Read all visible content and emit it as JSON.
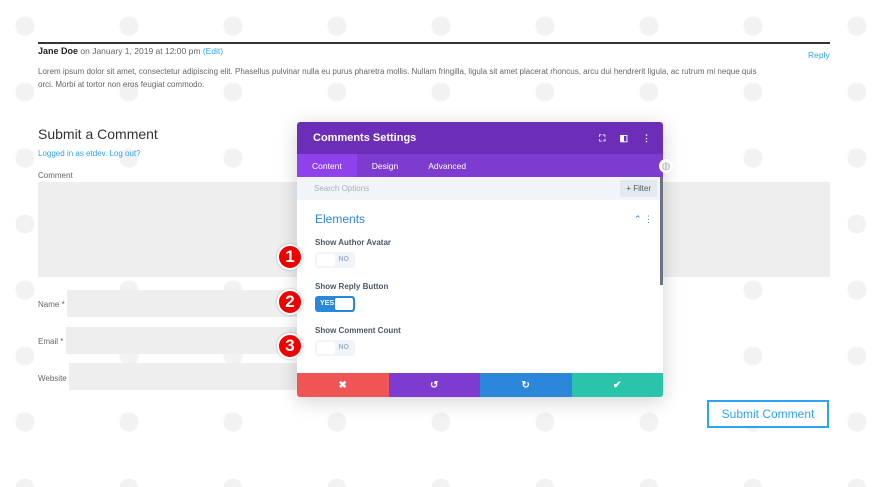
{
  "comment": {
    "author": "Jane Doe",
    "date": " on January 1, 2019 at 12:00 pm ",
    "edit": "(Edit)",
    "reply": "Reply",
    "body": "Lorem ipsum dolor sit amet, consectetur adipiscing elit. Phasellus pulvinar nulla eu purus pharetra mollis. Nullam fringilla, ligula sit amet placerat rhoncus, arcu dui hendrerit ligula, ac rutrum mi neque quis orci. Morbi at tortor non eros feugiat commodo."
  },
  "form": {
    "title": "Submit a Comment",
    "logged_in": "Logged in as etdev. Log out?",
    "comment_label": "Comment",
    "name_label": "Name *",
    "email_label": "Email *",
    "website_label": "Website",
    "submit": "Submit Comment"
  },
  "modal": {
    "title": "Comments Settings",
    "tabs": [
      "Content",
      "Design",
      "Advanced"
    ],
    "search_placeholder": "Search Options",
    "filter": "+ Filter",
    "section": "Elements",
    "options": [
      {
        "label": "Show Author Avatar",
        "state": "NO"
      },
      {
        "label": "Show Reply Button",
        "state": "YES"
      },
      {
        "label": "Show Comment Count",
        "state": "NO"
      }
    ],
    "footer_colors": [
      "#ef5555",
      "#7e3bd0",
      "#2b87da",
      "#29c4a9"
    ]
  },
  "markers": [
    "1",
    "2",
    "3"
  ]
}
